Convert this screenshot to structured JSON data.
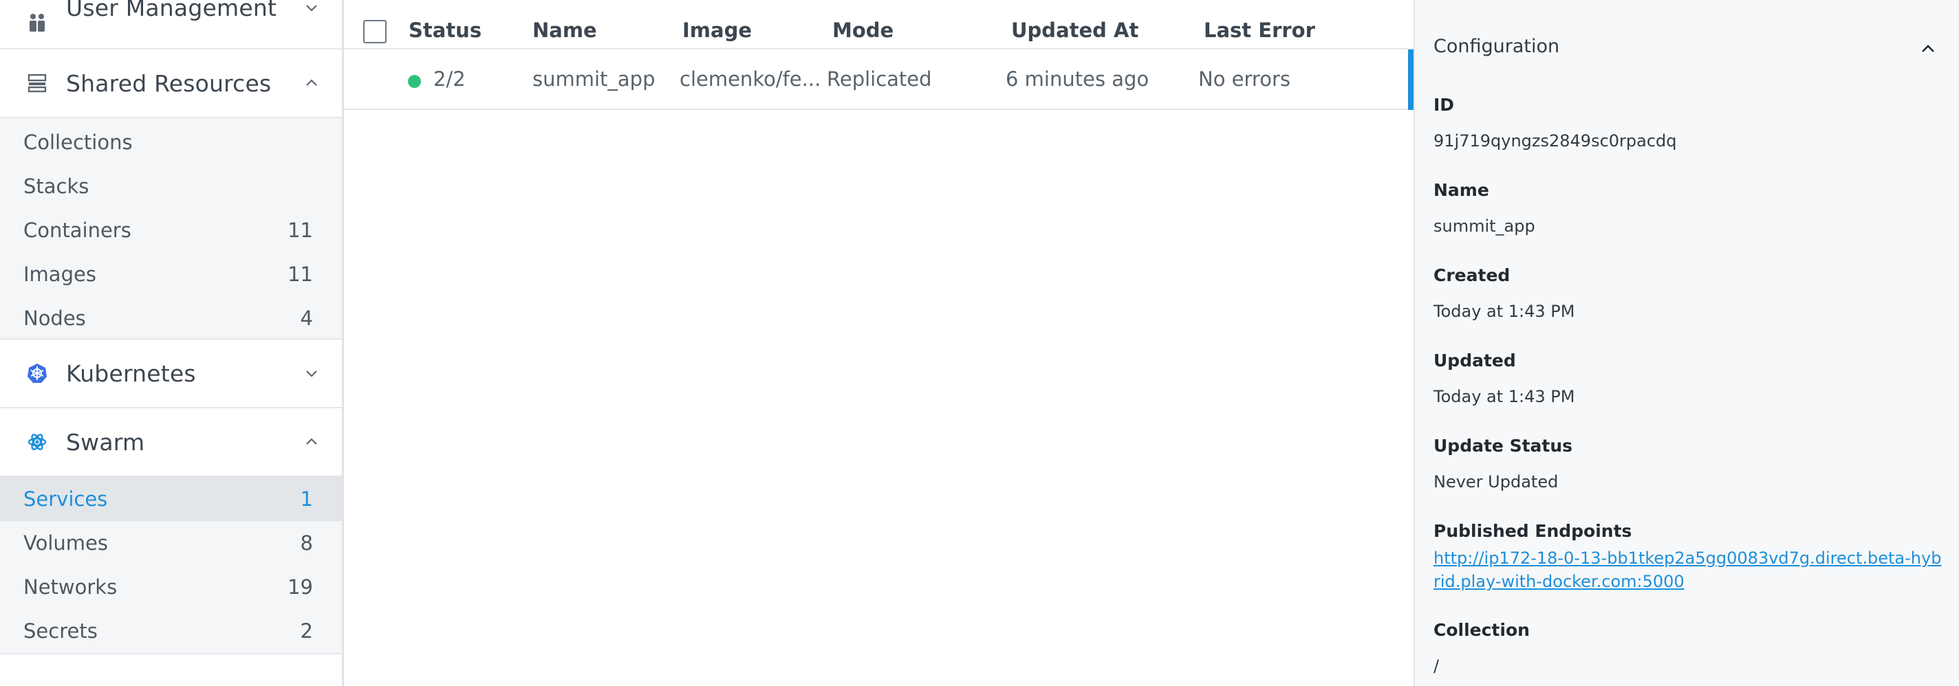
{
  "sidebar": {
    "user_management": {
      "label": "User Management"
    },
    "shared_resources": {
      "label": "Shared Resources",
      "items": [
        {
          "label": "Collections",
          "count": ""
        },
        {
          "label": "Stacks",
          "count": ""
        },
        {
          "label": "Containers",
          "count": "11"
        },
        {
          "label": "Images",
          "count": "11"
        },
        {
          "label": "Nodes",
          "count": "4"
        }
      ]
    },
    "kubernetes": {
      "label": "Kubernetes"
    },
    "swarm": {
      "label": "Swarm",
      "items": [
        {
          "label": "Services",
          "count": "1",
          "active": true
        },
        {
          "label": "Volumes",
          "count": "8"
        },
        {
          "label": "Networks",
          "count": "19"
        },
        {
          "label": "Secrets",
          "count": "2"
        }
      ]
    }
  },
  "table": {
    "headers": {
      "status": "Status",
      "name": "Name",
      "image": "Image",
      "mode": "Mode",
      "updated_at": "Updated At",
      "last_error": "Last Error"
    },
    "rows": [
      {
        "status": "2/2",
        "name": "summit_app",
        "image": "clemenko/fe...",
        "mode": "Replicated",
        "updated_at": "6 minutes ago",
        "last_error": "No errors"
      }
    ]
  },
  "panel": {
    "title": "Configuration",
    "fields": {
      "id": {
        "label": "ID",
        "value": "91j719qyngzs2849sc0rpacdq"
      },
      "name": {
        "label": "Name",
        "value": "summit_app"
      },
      "created": {
        "label": "Created",
        "value": "Today at 1:43 PM"
      },
      "updated": {
        "label": "Updated",
        "value": "Today at 1:43 PM"
      },
      "update_status": {
        "label": "Update Status",
        "value": "Never Updated"
      },
      "published_endpoints": {
        "label": "Published Endpoints",
        "value": "http://ip172-18-0-13-bb1tkep2a5gg0083vd7g.direct.beta-hybrid.play-with-docker.com:5000"
      },
      "collection": {
        "label": "Collection",
        "value": "/"
      }
    }
  },
  "colors": {
    "accent": "#1d8fdb",
    "status_ok": "#2ec27e",
    "sidebar_active_bg": "#e3e6e9"
  },
  "icons": {
    "user_management": "users-icon",
    "shared_resources": "stack-icon",
    "kubernetes": "kubernetes-icon",
    "swarm": "swarm-icon"
  }
}
